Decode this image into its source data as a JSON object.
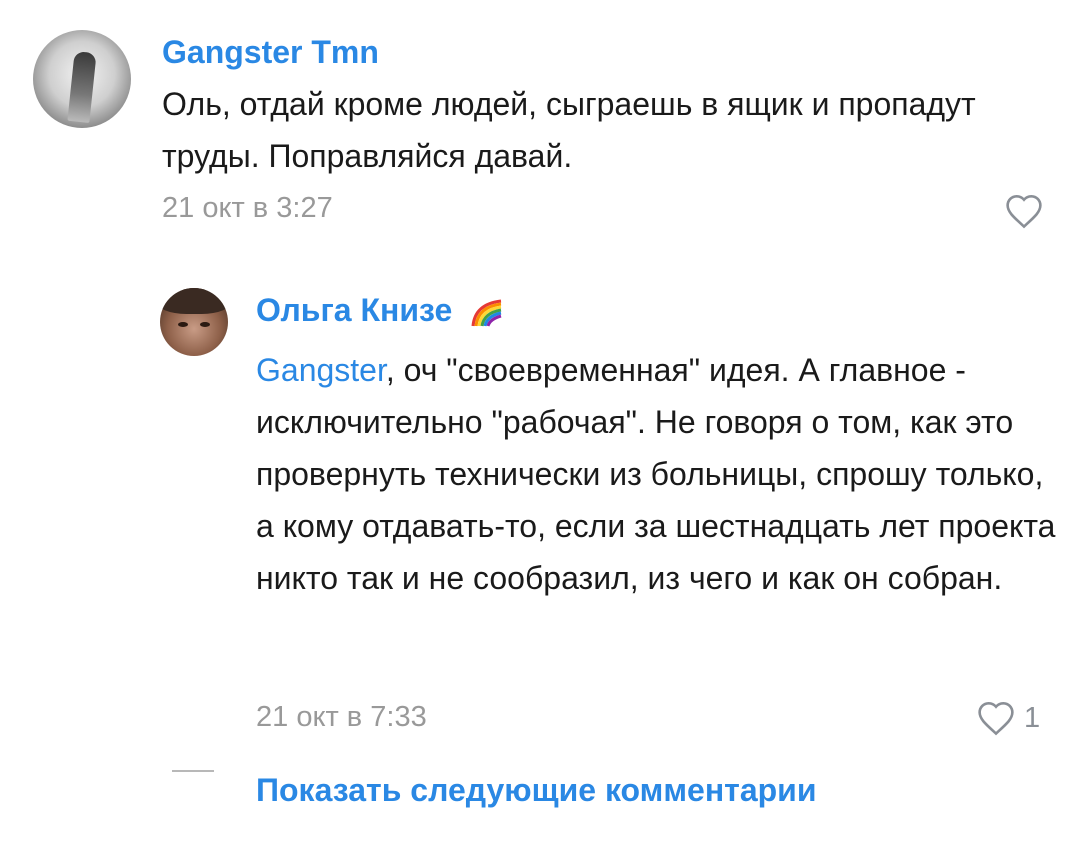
{
  "comments": [
    {
      "author": "Gangster Tmn",
      "text": "Оль, отдай кроме людей, сыграешь в ящик и пропадут труды. Поправляйся давай.",
      "time": "21 окт в 3:27",
      "likes": ""
    },
    {
      "author": "Ольга Книзе",
      "author_emoji": "rainbow-icon",
      "mention": "Gangster",
      "text": ", оч \"своевременная\" идея. А главное - исключительно \"рабочая\". Не говоря о том, как это провернуть технически из больницы, спрошу только, а кому отдавать-то, если за шестнадцать лет проекта никто так и не сообразил, из чего и как он собран.",
      "time": "21 окт в 7:33",
      "likes": "1"
    }
  ],
  "show_more": "Показать следующие комментарии",
  "colors": {
    "link": "#2a88e4",
    "text": "#1a1a1a",
    "muted": "#999999"
  }
}
